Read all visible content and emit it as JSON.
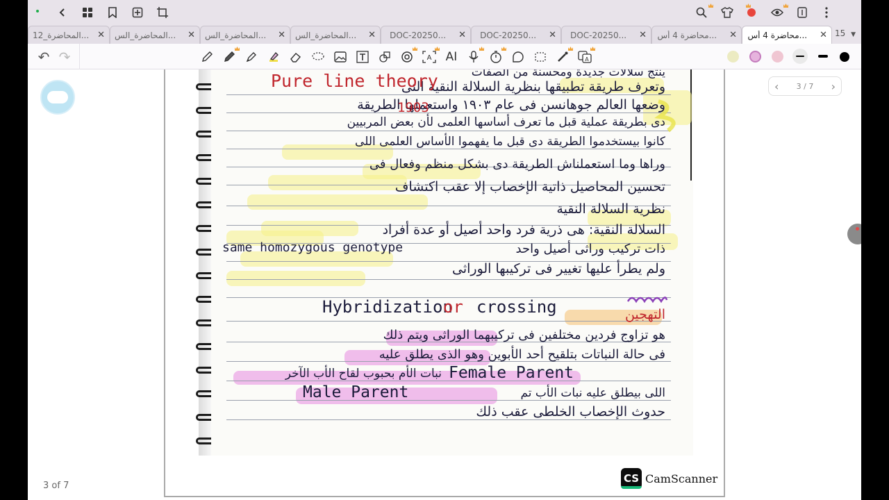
{
  "topbar": {
    "icons": [
      "back-icon",
      "grid-icon",
      "bookmark-icon",
      "add-page-icon",
      "crop-icon",
      "search-icon",
      "shirt-icon",
      "pin-icon",
      "eye-icon",
      "reader-icon",
      "more-icon"
    ]
  },
  "tabs": [
    {
      "label": "المحاضرة_12...",
      "close": "✕"
    },
    {
      "label": "المحاضرة_الس...",
      "close": "✕"
    },
    {
      "label": "المحاضرة_الس...",
      "close": "✕"
    },
    {
      "label": "المحاضرة_الس...",
      "close": "✕"
    },
    {
      "label": "DOC-20250...",
      "close": "✕"
    },
    {
      "label": "DOC-20250...",
      "close": "✕"
    },
    {
      "label": "DOC-20250...",
      "close": "✕"
    },
    {
      "label": "محاضرة 4 أس...",
      "close": "✕"
    },
    {
      "label": "محاضرة 4 أس...",
      "close": "✕",
      "active": true
    }
  ],
  "tab_count": "15",
  "toolbar": {
    "undo": "↶",
    "redo": "↷",
    "tools": [
      "pencil-icon",
      "pen-icon",
      "marker-icon",
      "highlighter-icon",
      "eraser-icon",
      "lasso-icon",
      "image-icon",
      "text-box-icon",
      "shapes-icon",
      "stamp-icon",
      "ocr-icon",
      "ai-icon",
      "microphone-icon",
      "timer-icon",
      "sticker-icon",
      "screenshot-icon",
      "laser-icon",
      "translate-icon"
    ],
    "ai_label": "AI",
    "colors": [
      "#ecebc2",
      "#e6b3dd",
      "#f0c6d2",
      "#eaeaea"
    ]
  },
  "document": {
    "page_indicator": "3 of 7",
    "pager": {
      "prev": "‹",
      "label": "3 / 7",
      "next": "›"
    },
    "camscanner_logo": "CS",
    "camscanner_name": "CamScanner",
    "english_terms": {
      "pure_line": "Pure line theory",
      "year": "1903",
      "homozygous": "same homozygous genotype",
      "hybridization": "Hybridization",
      "or": "or",
      "crossing": "crossing",
      "female": "Female Parent",
      "male": "Male Parent"
    },
    "lines": [
      "ينتج سلالات جديدة ومحسنة من الصفات",
      "وتعرف طريقة تطبيقها بنظرية السلالة النقية التى",
      "وضعها العالم جوهانسن فى عام ١٩٠٣ واستعملها الطريقة",
      "دى بطريقة عملية قبل ما تعرف أساسها العلمى لأن بعض المربيين",
      "كانوا بيستخدموا الطريقة دى قبل ما يفهموا الأساس العلمى اللى",
      "وراها وما استعملناش الطريقة دى بشكل منظم وفعال فى",
      "تحسين المحاصيل ذاتية الإخصاب إلا عقب اكتشاف",
      "نظرية السلالة النقية",
      "السلالة النقية: هى ذرية فرد واحد أصيل أو عدة أفراد",
      "ذات تركيب وراثى أصيل واحد",
      "ولم يطرأ عليها تغيير فى تركيبها الوراثى",
      "التهجين",
      "هو تزاوج فردين مختلفين فى تركيبهما الوراثى ويتم ذلك",
      "فى حالة النباتات بتلقيح أحد الأبوين وهو الذى يطلق عليه",
      "نبات الأم بحبوب لقاح الأب الآخر",
      "اللى بيطلق عليه نبات الأب تم",
      "حدوث الإخصاب الخلطى عقب ذلك"
    ]
  }
}
